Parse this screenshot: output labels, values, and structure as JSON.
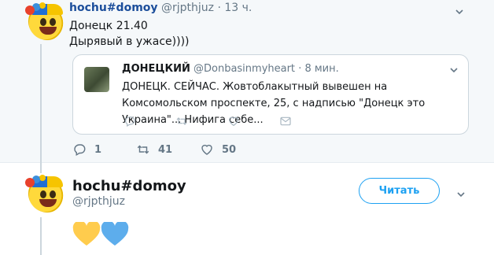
{
  "tweet1": {
    "name": "hochu#domoy",
    "handle": "@rjpthjuz",
    "time": "· 13 ч.",
    "text_line1": "Донецк 21.40",
    "text_line2": "Дырявый в ужасе))))",
    "quote": {
      "name": "ДОНЕЦКИЙ",
      "handle": "@Donbasinmyheart",
      "time": "· 8 мин.",
      "text": "ДОНЕЦК. СЕЙЧАС. Жовтоблакытный вывешен на Комсомольском проспекте, 25, с надписью \"Донецк это Украина\"... Нифига себе..."
    },
    "actions": {
      "reply_count": "1",
      "retweet_count": "41",
      "like_count": "50"
    }
  },
  "tweet2": {
    "name": "hochu#domoy",
    "handle": "@rjpthjuz",
    "follow_label": "Читать",
    "emoji": [
      "yellow-heart",
      "blue-heart"
    ]
  },
  "colors": {
    "accent": "#1da1f2",
    "background_top": "#f5f8fa",
    "yellow_heart": "#ffcc4d",
    "blue_heart": "#5dadec"
  }
}
